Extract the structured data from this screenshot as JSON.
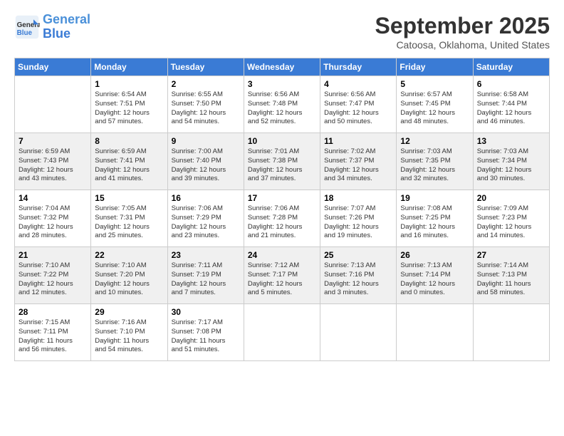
{
  "header": {
    "logo_line1": "General",
    "logo_line2": "Blue",
    "month": "September 2025",
    "location": "Catoosa, Oklahoma, United States"
  },
  "weekdays": [
    "Sunday",
    "Monday",
    "Tuesday",
    "Wednesday",
    "Thursday",
    "Friday",
    "Saturday"
  ],
  "rows": [
    [
      {
        "day": "",
        "info": ""
      },
      {
        "day": "1",
        "info": "Sunrise: 6:54 AM\nSunset: 7:51 PM\nDaylight: 12 hours\nand 57 minutes."
      },
      {
        "day": "2",
        "info": "Sunrise: 6:55 AM\nSunset: 7:50 PM\nDaylight: 12 hours\nand 54 minutes."
      },
      {
        "day": "3",
        "info": "Sunrise: 6:56 AM\nSunset: 7:48 PM\nDaylight: 12 hours\nand 52 minutes."
      },
      {
        "day": "4",
        "info": "Sunrise: 6:56 AM\nSunset: 7:47 PM\nDaylight: 12 hours\nand 50 minutes."
      },
      {
        "day": "5",
        "info": "Sunrise: 6:57 AM\nSunset: 7:45 PM\nDaylight: 12 hours\nand 48 minutes."
      },
      {
        "day": "6",
        "info": "Sunrise: 6:58 AM\nSunset: 7:44 PM\nDaylight: 12 hours\nand 46 minutes."
      }
    ],
    [
      {
        "day": "7",
        "info": "Sunrise: 6:59 AM\nSunset: 7:43 PM\nDaylight: 12 hours\nand 43 minutes."
      },
      {
        "day": "8",
        "info": "Sunrise: 6:59 AM\nSunset: 7:41 PM\nDaylight: 12 hours\nand 41 minutes."
      },
      {
        "day": "9",
        "info": "Sunrise: 7:00 AM\nSunset: 7:40 PM\nDaylight: 12 hours\nand 39 minutes."
      },
      {
        "day": "10",
        "info": "Sunrise: 7:01 AM\nSunset: 7:38 PM\nDaylight: 12 hours\nand 37 minutes."
      },
      {
        "day": "11",
        "info": "Sunrise: 7:02 AM\nSunset: 7:37 PM\nDaylight: 12 hours\nand 34 minutes."
      },
      {
        "day": "12",
        "info": "Sunrise: 7:03 AM\nSunset: 7:35 PM\nDaylight: 12 hours\nand 32 minutes."
      },
      {
        "day": "13",
        "info": "Sunrise: 7:03 AM\nSunset: 7:34 PM\nDaylight: 12 hours\nand 30 minutes."
      }
    ],
    [
      {
        "day": "14",
        "info": "Sunrise: 7:04 AM\nSunset: 7:32 PM\nDaylight: 12 hours\nand 28 minutes."
      },
      {
        "day": "15",
        "info": "Sunrise: 7:05 AM\nSunset: 7:31 PM\nDaylight: 12 hours\nand 25 minutes."
      },
      {
        "day": "16",
        "info": "Sunrise: 7:06 AM\nSunset: 7:29 PM\nDaylight: 12 hours\nand 23 minutes."
      },
      {
        "day": "17",
        "info": "Sunrise: 7:06 AM\nSunset: 7:28 PM\nDaylight: 12 hours\nand 21 minutes."
      },
      {
        "day": "18",
        "info": "Sunrise: 7:07 AM\nSunset: 7:26 PM\nDaylight: 12 hours\nand 19 minutes."
      },
      {
        "day": "19",
        "info": "Sunrise: 7:08 AM\nSunset: 7:25 PM\nDaylight: 12 hours\nand 16 minutes."
      },
      {
        "day": "20",
        "info": "Sunrise: 7:09 AM\nSunset: 7:23 PM\nDaylight: 12 hours\nand 14 minutes."
      }
    ],
    [
      {
        "day": "21",
        "info": "Sunrise: 7:10 AM\nSunset: 7:22 PM\nDaylight: 12 hours\nand 12 minutes."
      },
      {
        "day": "22",
        "info": "Sunrise: 7:10 AM\nSunset: 7:20 PM\nDaylight: 12 hours\nand 10 minutes."
      },
      {
        "day": "23",
        "info": "Sunrise: 7:11 AM\nSunset: 7:19 PM\nDaylight: 12 hours\nand 7 minutes."
      },
      {
        "day": "24",
        "info": "Sunrise: 7:12 AM\nSunset: 7:17 PM\nDaylight: 12 hours\nand 5 minutes."
      },
      {
        "day": "25",
        "info": "Sunrise: 7:13 AM\nSunset: 7:16 PM\nDaylight: 12 hours\nand 3 minutes."
      },
      {
        "day": "26",
        "info": "Sunrise: 7:13 AM\nSunset: 7:14 PM\nDaylight: 12 hours\nand 0 minutes."
      },
      {
        "day": "27",
        "info": "Sunrise: 7:14 AM\nSunset: 7:13 PM\nDaylight: 11 hours\nand 58 minutes."
      }
    ],
    [
      {
        "day": "28",
        "info": "Sunrise: 7:15 AM\nSunset: 7:11 PM\nDaylight: 11 hours\nand 56 minutes."
      },
      {
        "day": "29",
        "info": "Sunrise: 7:16 AM\nSunset: 7:10 PM\nDaylight: 11 hours\nand 54 minutes."
      },
      {
        "day": "30",
        "info": "Sunrise: 7:17 AM\nSunset: 7:08 PM\nDaylight: 11 hours\nand 51 minutes."
      },
      {
        "day": "",
        "info": ""
      },
      {
        "day": "",
        "info": ""
      },
      {
        "day": "",
        "info": ""
      },
      {
        "day": "",
        "info": ""
      }
    ]
  ]
}
